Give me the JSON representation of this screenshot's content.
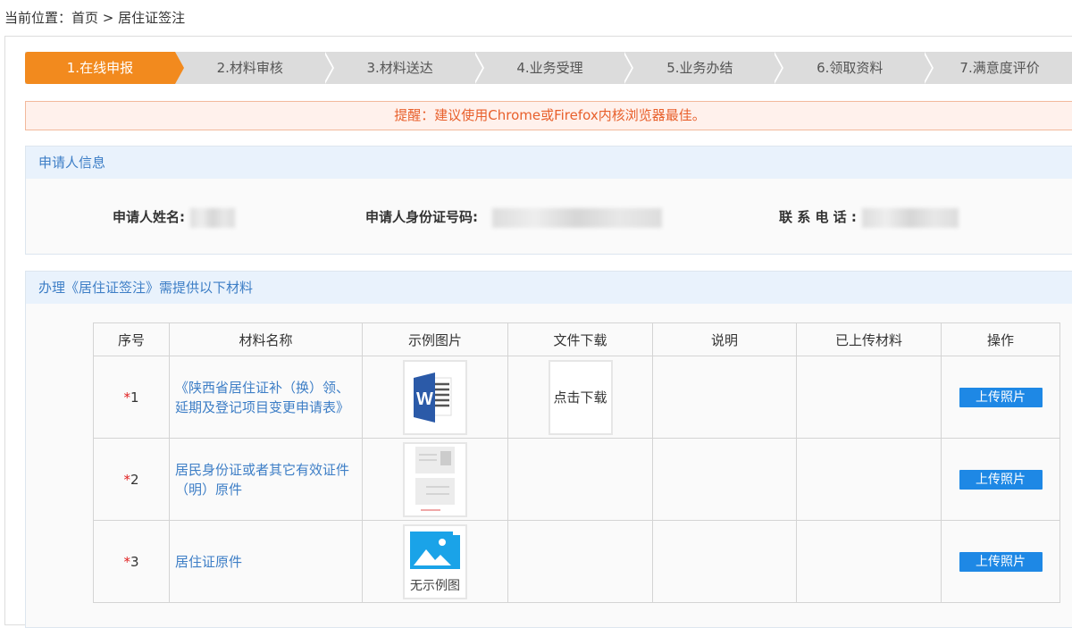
{
  "breadcrumb": "当前位置：首页 > 居住证签注",
  "steps": [
    "1.在线申报",
    "2.材料审核",
    "3.材料送达",
    "4.业务受理",
    "5.业务办结",
    "6.领取资料",
    "7.满意度评价"
  ],
  "alert": "提醒：建议使用Chrome或Firefox内核浏览器最佳。",
  "applicant": {
    "title": "申请人信息",
    "name_label": "申请人姓名:",
    "id_label": "申请人身份证号码:",
    "phone_label": "联 系 电 话 :"
  },
  "materials": {
    "title": "办理《居住证签注》需提供以下材料",
    "headers": [
      "序号",
      "材料名称",
      "示例图片",
      "文件下载",
      "说明",
      "已上传材料",
      "操作"
    ],
    "rows": [
      {
        "no": "1",
        "name": "《陕西省居住证补（换）领、延期及登记项目变更申请表》",
        "download": "点击下载",
        "action": "上传照片"
      },
      {
        "no": "2",
        "name": "居民身份证或者其它有效证件（明）原件",
        "action": "上传照片"
      },
      {
        "no": "3",
        "name": "居住证原件",
        "thumb_caption": "无示例图",
        "action": "上传照片"
      }
    ]
  },
  "colors": {
    "accent": "#f28a1e",
    "link": "#3d7ec6",
    "button": "#1e88e5"
  }
}
